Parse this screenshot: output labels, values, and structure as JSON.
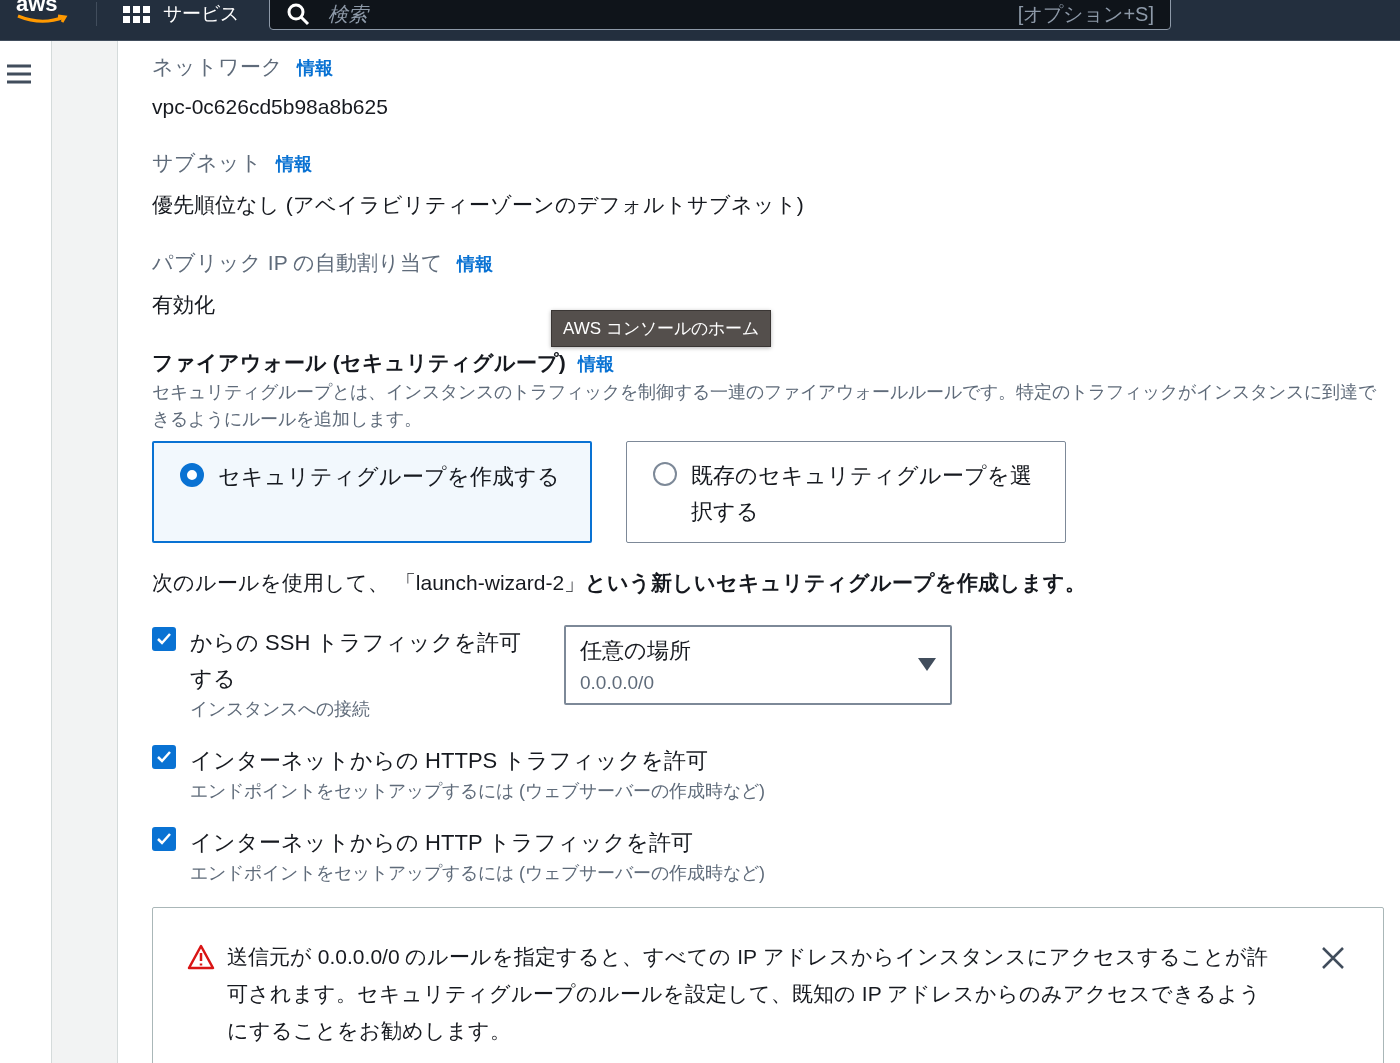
{
  "header": {
    "logo": "aws",
    "services": "サービス",
    "search": {
      "placeholder": "検索",
      "shortcut": "[オプション+S]"
    }
  },
  "tooltip": "AWS コンソールのホーム",
  "fields": [
    {
      "label": "ネットワーク",
      "info": "情報",
      "value": "vpc-0c626cd5b98a8b625"
    },
    {
      "label": "サブネット",
      "info": "情報",
      "value": "優先順位なし (アベイラビリティーゾーンのデフォルトサブネット)"
    },
    {
      "label": "パブリック IP の自動割り当て",
      "info": "情報",
      "value": "有効化"
    }
  ],
  "firewall": {
    "title": "ファイアウォール (セキュリティグループ)",
    "info": "情報",
    "description": "セキュリティグループとは、インスタンスのトラフィックを制御する一連のファイアウォールルールです。特定のトラフィックがインスタンスに到達できるようにルールを追加します。",
    "options": [
      {
        "label": "セキュリティグループを作成する",
        "selected": true
      },
      {
        "label": "既存のセキュリティグループを選択する",
        "selected": false
      }
    ],
    "rule_note": "次のルールを使用して、 「launch-wizard-2」**という新しいセキュリティグループを作成します。**",
    "rules": [
      {
        "label": "からの SSH トラフィックを許可する",
        "hint": "インスタンスへの接続",
        "checked": true,
        "select": {
          "value": "任意の場所",
          "detail": "0.0.0.0/0"
        }
      },
      {
        "label": "インターネットからの HTTPS トラフィックを許可",
        "hint": "エンドポイントをセットアップするには (ウェブサーバーの作成時など)",
        "checked": true
      },
      {
        "label": "インターネットからの HTTP トラフィックを許可",
        "hint": "エンドポイントをセットアップするには (ウェブサーバーの作成時など)",
        "checked": true
      }
    ],
    "warning": {
      "text": "送信元が 0.0.0.0/0 のルールを指定すると、すべての IP アドレスからインスタンスにアクセスすることが許可されます。セキュリティグループのルールを設定して、既知の IP アドレスからのみアクセスできるようにすることをお勧めします。"
    }
  }
}
